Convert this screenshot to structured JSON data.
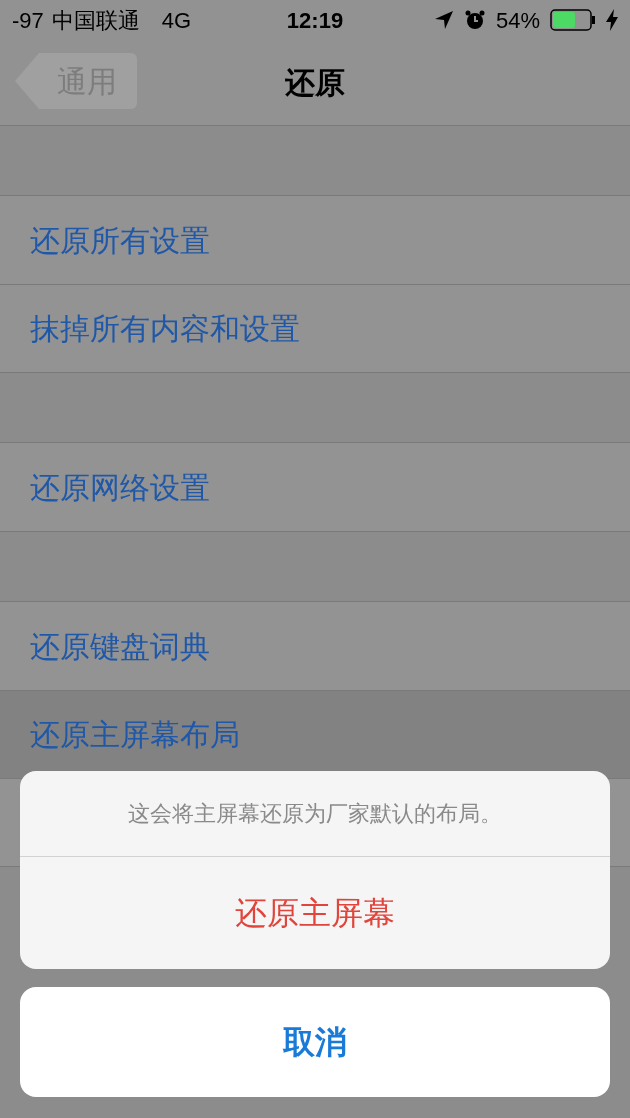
{
  "status_bar": {
    "signal": "-97",
    "carrier": "中国联通",
    "network": "4G",
    "time": "12:19",
    "battery": "54%"
  },
  "nav": {
    "back": "通用",
    "title": "还原"
  },
  "groups": [
    {
      "rows": [
        {
          "label": "还原所有设置",
          "selected": false
        },
        {
          "label": "抹掉所有内容和设置",
          "selected": false
        }
      ]
    },
    {
      "rows": [
        {
          "label": "还原网络设置",
          "selected": false
        }
      ]
    },
    {
      "rows": [
        {
          "label": "还原键盘词典",
          "selected": false
        },
        {
          "label": "还原主屏幕布局",
          "selected": true
        }
      ]
    }
  ],
  "action_sheet": {
    "message": "这会将主屏幕还原为厂家默认的布局。",
    "actions": [
      {
        "label": "还原主屏幕",
        "kind": "destructive"
      }
    ],
    "cancel": "取消"
  }
}
